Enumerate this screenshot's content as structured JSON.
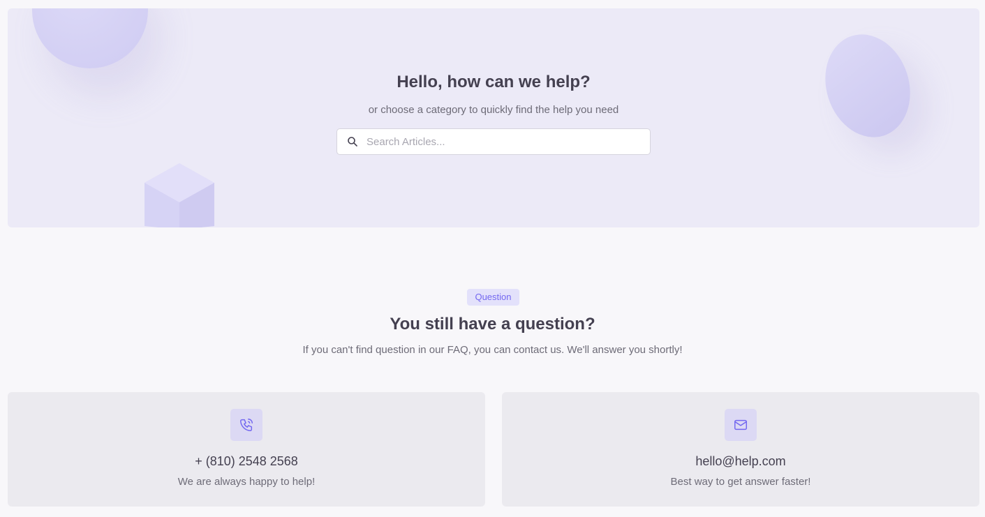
{
  "hero": {
    "title": "Hello, how can we help?",
    "subtitle": "or choose a category to quickly find the help you need",
    "search_placeholder": "Search Articles..."
  },
  "question": {
    "badge": "Question",
    "title": "You still have a question?",
    "subtitle": "If you can't find question in our FAQ, you can contact us. We'll answer you shortly!"
  },
  "contacts": [
    {
      "icon": "phone-icon",
      "value": "+ (810) 2548 2568",
      "description": "We are always happy to help!"
    },
    {
      "icon": "mail-icon",
      "value": "hello@help.com",
      "description": "Best way to get answer faster!"
    }
  ],
  "colors": {
    "accent": "#7367f0",
    "hero_bg": "#eceaf7",
    "card_bg": "#ebeaef",
    "badge_bg": "#e3e1fb"
  }
}
